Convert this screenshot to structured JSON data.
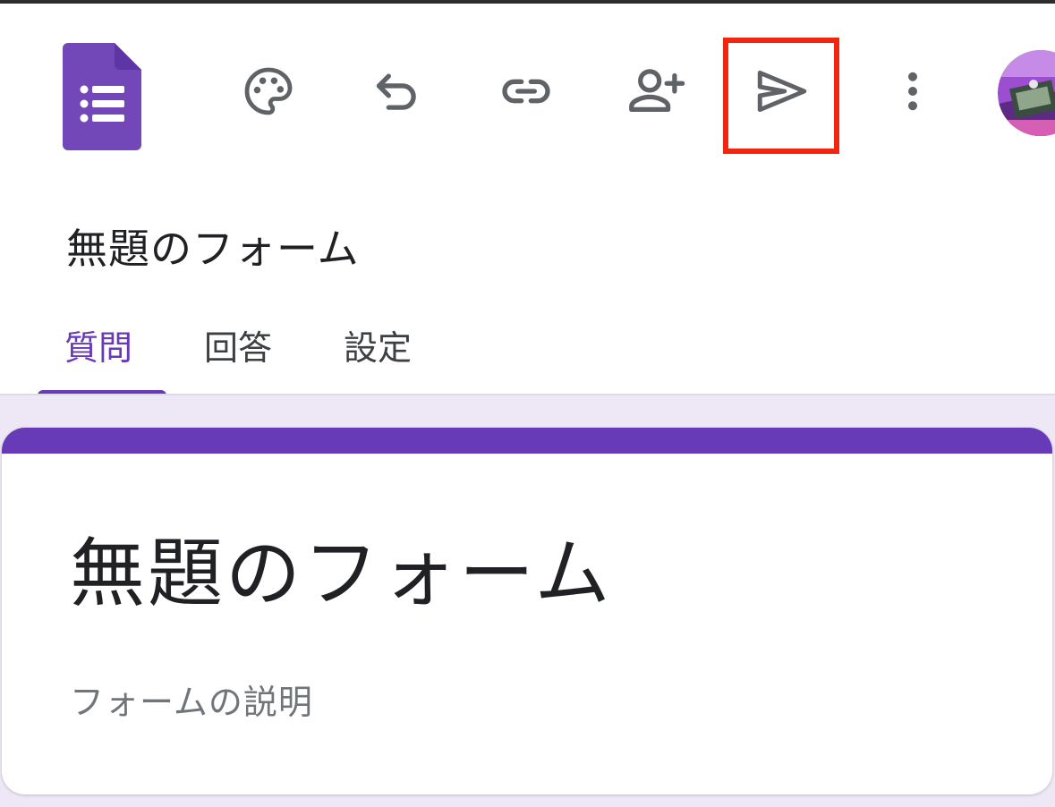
{
  "app": {
    "icon": "google-forms-icon",
    "brand_color": "#673ab7",
    "tab_bg": "#ede7f6",
    "highlight_color": "#f2260e"
  },
  "toolbar": {
    "icons": [
      "palette-icon",
      "undo-icon",
      "link-icon",
      "add-collaborator-icon",
      "send-icon",
      "more-vert-icon"
    ],
    "highlighted": "send-icon"
  },
  "header": {
    "title": "無題のフォーム"
  },
  "tabs": [
    {
      "label": "質問",
      "active": true
    },
    {
      "label": "回答",
      "active": false
    },
    {
      "label": "設定",
      "active": false
    }
  ],
  "form": {
    "title": "無題のフォーム",
    "description_placeholder": "フォームの説明"
  }
}
